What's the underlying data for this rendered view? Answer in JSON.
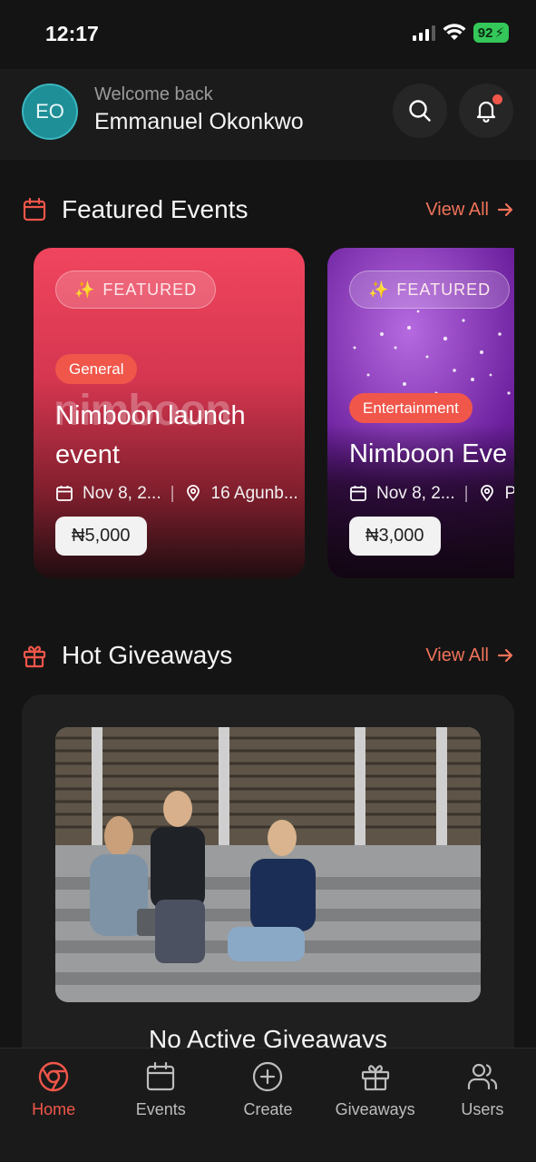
{
  "status_bar": {
    "time": "12:17",
    "battery": "92"
  },
  "header": {
    "avatar_initials": "EO",
    "welcome_text": "Welcome back",
    "user_name": "Emmanuel Okonkwo"
  },
  "featured": {
    "title": "Featured Events",
    "view_all": "View All",
    "cards": [
      {
        "badge": "FEATURED",
        "category": "General",
        "brand_watermark": "nimboon",
        "title_line1": "Nimboon launch",
        "title_line2": "event",
        "date": "Nov 8, 2...",
        "location": "16 Agunb...",
        "price": "₦5,000"
      },
      {
        "badge": "FEATURED",
        "category": "Entertainment",
        "title_line1": "Nimboon Eve",
        "date": "Nov 8, 2...",
        "location": "P",
        "price": "₦3,000"
      }
    ]
  },
  "giveaways": {
    "title": "Hot Giveaways",
    "view_all": "View All",
    "empty_title": "No Active Giveaways"
  },
  "nav": {
    "items": [
      {
        "label": "Home",
        "icon": "chrome-icon",
        "active": true
      },
      {
        "label": "Events",
        "icon": "calendar-icon",
        "active": false
      },
      {
        "label": "Create",
        "icon": "plus-circle-icon",
        "active": false
      },
      {
        "label": "Giveaways",
        "icon": "gift-icon",
        "active": false
      },
      {
        "label": "Users",
        "icon": "users-icon",
        "active": false
      }
    ]
  },
  "colors": {
    "accent": "#f0564a",
    "link": "#f0735a",
    "background": "#141414",
    "avatar": "#1f8f97"
  }
}
